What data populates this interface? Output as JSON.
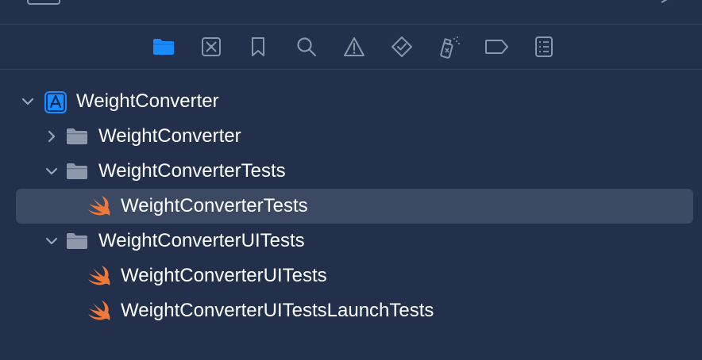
{
  "toolbar": {
    "icons": [
      "folder-icon",
      "source-control-icon",
      "bookmark-icon",
      "search-icon",
      "warning-icon",
      "test-diamond-icon",
      "debug-spray-icon",
      "breakpoint-tag-icon",
      "report-list-icon"
    ],
    "active": "folder-icon"
  },
  "colors": {
    "background": "#22304b",
    "selection": "#3b4963",
    "accent": "#1a8cff",
    "swift": "#f0793a",
    "folder": "#8d98ab"
  },
  "tree": {
    "project": {
      "label": "WeightConverter",
      "expanded": true
    },
    "group_app": {
      "label": "WeightConverter",
      "expanded": false
    },
    "group_tests": {
      "label": "WeightConverterTests",
      "expanded": true
    },
    "file_tests": {
      "label": "WeightConverterTests",
      "selected": true
    },
    "group_uitests": {
      "label": "WeightConverterUITests",
      "expanded": true
    },
    "file_uitests": {
      "label": "WeightConverterUITests"
    },
    "file_launch": {
      "label": "WeightConverterUITestsLaunchTests"
    }
  }
}
